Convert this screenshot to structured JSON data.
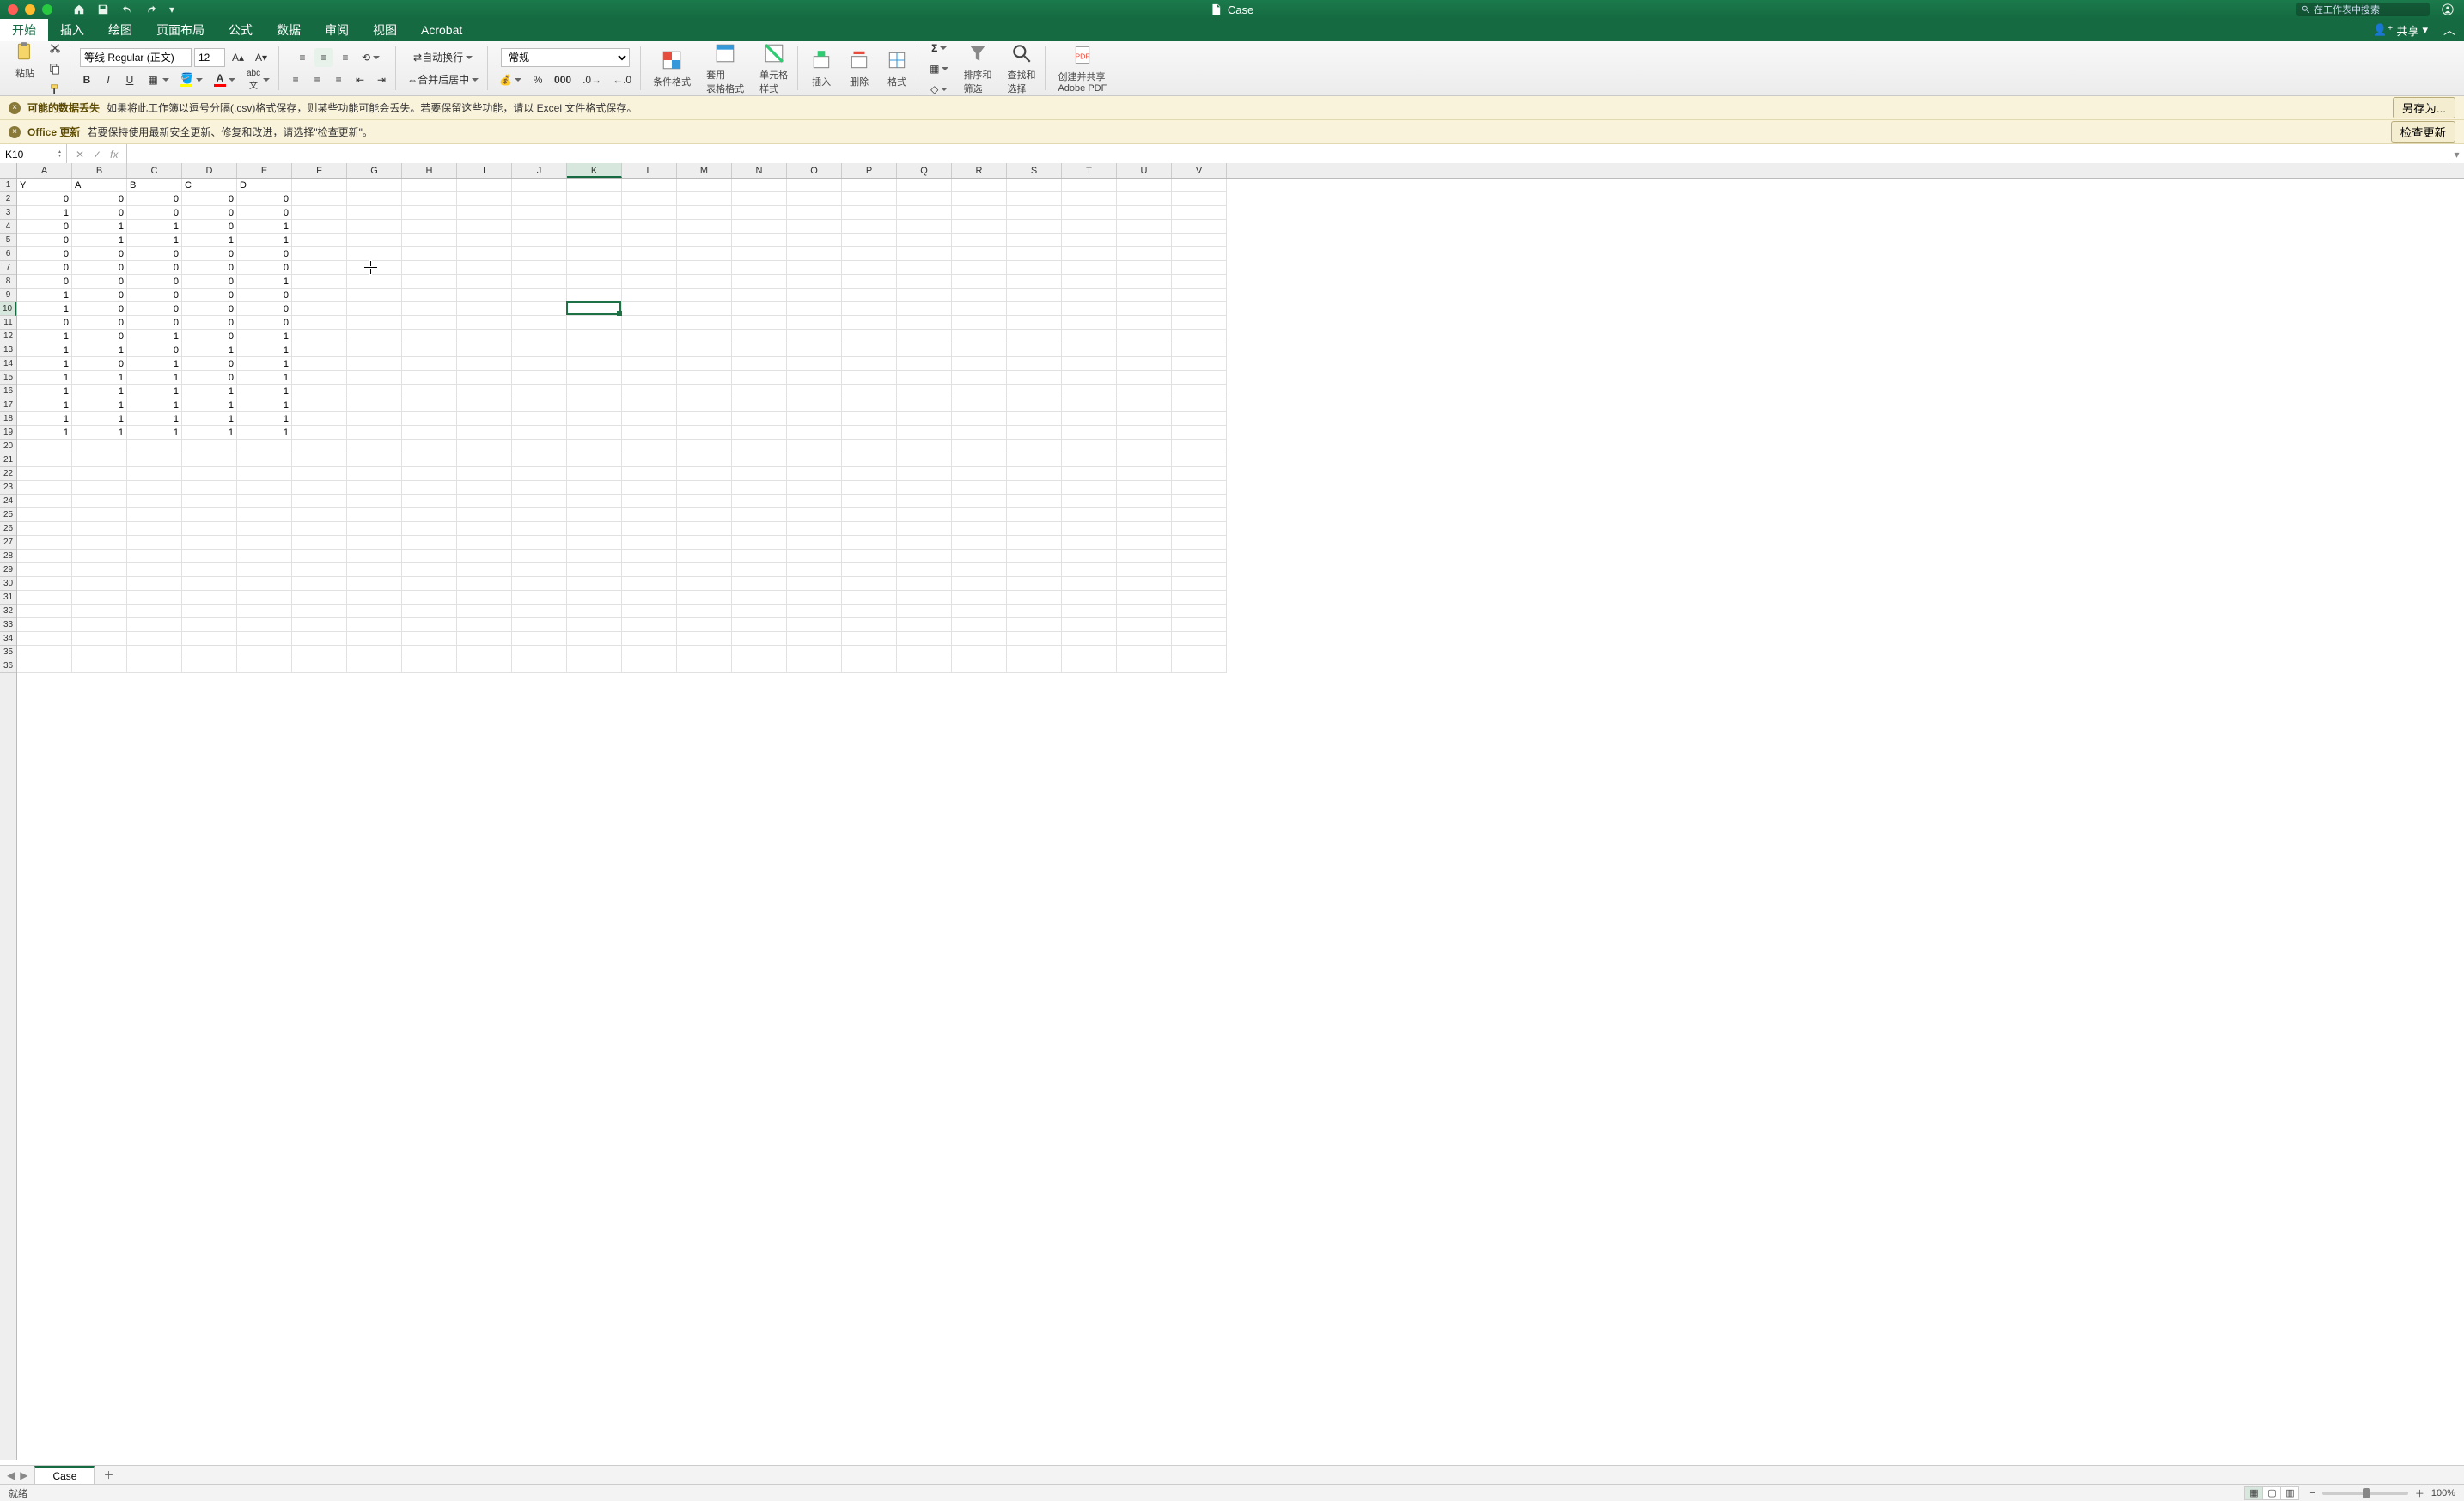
{
  "title": "Case",
  "search_placeholder": "在工作表中搜索",
  "menutabs": [
    "开始",
    "插入",
    "绘图",
    "页面布局",
    "公式",
    "数据",
    "审阅",
    "视图",
    "Acrobat"
  ],
  "share_label": "共享",
  "ribbon": {
    "paste": "粘贴",
    "font_name": "等线 Regular (正文)",
    "font_size": "12",
    "wrap_text": "自动换行",
    "merge_center": "合并后居中",
    "number_format": "常规",
    "cond_fmt": "条件格式",
    "table_fmt": "套用\n表格格式",
    "cell_style": "单元格\n样式",
    "insert": "插入",
    "delete": "删除",
    "format": "格式",
    "sort_filter": "排序和\n筛选",
    "find_select": "查找和\n选择",
    "adobe": "创建并共享\nAdobe PDF"
  },
  "warn1": {
    "title": "可能的数据丢失",
    "msg": "如果将此工作簿以逗号分隔(.csv)格式保存，则某些功能可能会丢失。若要保留这些功能，请以 Excel 文件格式保存。",
    "action": "另存为..."
  },
  "warn2": {
    "title": "Office 更新",
    "msg": "若要保持使用最新安全更新、修复和改进，请选择\"检查更新\"。",
    "action": "检查更新"
  },
  "namebox": "K10",
  "formula": "",
  "columns": [
    "A",
    "B",
    "C",
    "D",
    "E",
    "F",
    "G",
    "H",
    "I",
    "J",
    "K",
    "L",
    "M",
    "N",
    "O",
    "P",
    "Q",
    "R",
    "S",
    "T",
    "U",
    "V"
  ],
  "selected_col_index": 10,
  "selected_row_index": 9,
  "row_count": 36,
  "sheet_name": "Case",
  "status": "就绪",
  "zoom": "100%",
  "cells": {
    "header": [
      "Y",
      "A",
      "B",
      "C",
      "D"
    ],
    "data": [
      [
        0,
        0,
        0,
        0,
        0
      ],
      [
        1,
        0,
        0,
        0,
        0
      ],
      [
        0,
        1,
        1,
        0,
        1
      ],
      [
        0,
        1,
        1,
        1,
        1
      ],
      [
        0,
        0,
        0,
        0,
        0
      ],
      [
        0,
        0,
        0,
        0,
        0
      ],
      [
        0,
        0,
        0,
        0,
        1
      ],
      [
        1,
        0,
        0,
        0,
        0
      ],
      [
        1,
        0,
        0,
        0,
        0
      ],
      [
        0,
        0,
        0,
        0,
        0
      ],
      [
        1,
        0,
        1,
        0,
        1
      ],
      [
        1,
        1,
        0,
        1,
        1
      ],
      [
        1,
        0,
        1,
        0,
        1
      ],
      [
        1,
        1,
        1,
        0,
        1
      ],
      [
        1,
        1,
        1,
        1,
        1
      ],
      [
        1,
        1,
        1,
        1,
        1
      ],
      [
        1,
        1,
        1,
        1,
        1
      ],
      [
        1,
        1,
        1,
        1,
        1
      ]
    ]
  }
}
